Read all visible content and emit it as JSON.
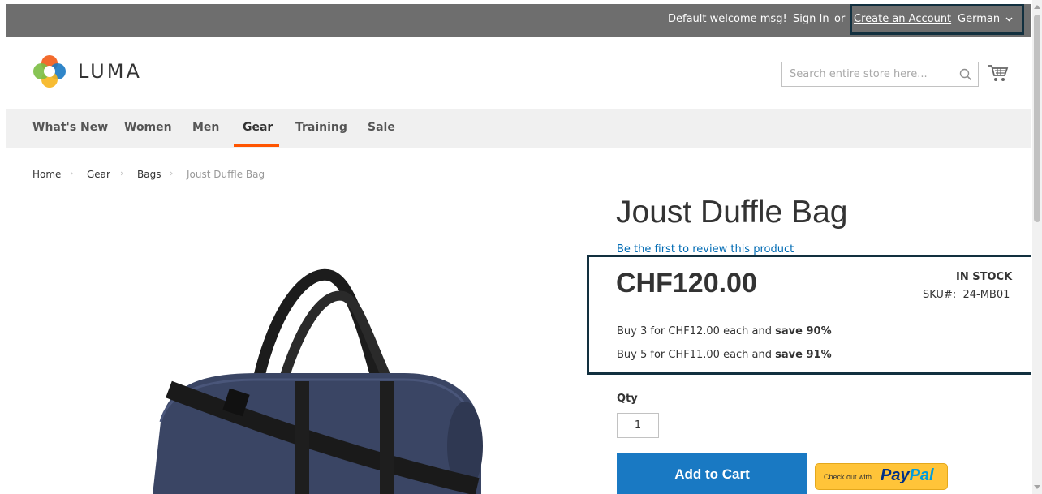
{
  "topbar": {
    "welcome": "Default welcome msg!",
    "sign_in": "Sign In",
    "or": "or",
    "create_account": "Create an Account",
    "language": "German"
  },
  "header": {
    "logo_text": "LUMA",
    "search_placeholder": "Search entire store here...",
    "search_icon": "search-icon",
    "cart_icon": "cart-icon"
  },
  "nav": {
    "items": [
      "What's New",
      "Women",
      "Men",
      "Gear",
      "Training",
      "Sale"
    ],
    "active": "Gear"
  },
  "breadcrumb": {
    "items": [
      "Home",
      "Gear",
      "Bags",
      "Joust Duffle Bag"
    ]
  },
  "product": {
    "name": "Joust Duffle Bag",
    "review_link": "Be the first to review this product",
    "price": "CHF120.00",
    "stock": "IN STOCK",
    "sku_label": "SKU#:",
    "sku": "24-MB01",
    "tiers": [
      {
        "text": "Buy 3 for CHF12.00 each and ",
        "save": "save 90%"
      },
      {
        "text": "Buy 5 for CHF11.00 each and ",
        "save": "save 91%"
      }
    ],
    "qty_label": "Qty",
    "qty_value": "1",
    "add_to_cart": "Add to Cart",
    "paypal_small": "Check out with",
    "paypal_brand_1": "Pay",
    "paypal_brand_2": "Pal"
  },
  "colors": {
    "topbar": "#6e6e6e",
    "nav_bg": "#f0f0f0",
    "accent_orange": "#ff5501",
    "button_blue": "#1979c3",
    "link_blue": "#006bb4",
    "highlight_border": "#12303f",
    "paypal_yellow": "#ffc439"
  }
}
